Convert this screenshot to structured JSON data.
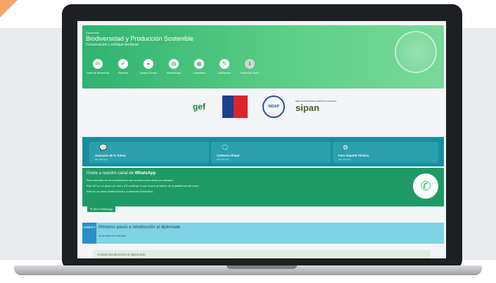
{
  "hero": {
    "label": "Diplomado",
    "title": "Biodiversidad y Producción Sostenible",
    "subtitle": "Conservación y enfoque territorial",
    "nav": [
      {
        "label": "Carta de bienvenida",
        "icon": "speech-bubble-icon"
      },
      {
        "label": "Objetivos",
        "icon": "check-icon"
      },
      {
        "label": "Equipo Técnico",
        "icon": "person-icon"
      },
      {
        "label": "Metodología",
        "icon": "document-icon"
      },
      {
        "label": "Calendario",
        "icon": "calendar-icon"
      },
      {
        "label": "Evaluación",
        "icon": "edit-icon"
      },
      {
        "label": "Fecha del Curso",
        "icon": "info-icon"
      }
    ]
  },
  "logos": {
    "gef": "gef",
    "indap": "INDAP",
    "sipan_small": "RED DE PATRIMONIO AGRÍCOLA NACIONAL",
    "sipan": "sipan"
  },
  "cards": [
    {
      "title": "Anuncios de la Tutora",
      "sub": "Mar 202 Appl"
    },
    {
      "title": "Cafetería Virtual",
      "sub": "Mar 202 Appl"
    },
    {
      "title": "Foro Soporte Técnico",
      "sub": "Mar 202 Appl"
    }
  ],
  "whatsapp": {
    "title_plain": "Únete a nuestro canal de ",
    "title_bold": "WhatsApp",
    "lines": [
      "Para enterarte de los recordatorios que enviamos dos veces por semana.",
      "Este NO es un grupo de chat y NO sustituye lo que ocurre al interior de la plataforma del curso.",
      "Este es un canal unidireccional y puramente informativo."
    ],
    "button": "Abrir WhatsApp"
  },
  "unidad": {
    "badge": "Unidad 0",
    "title": "Primeros pasos e introducción al diplomado",
    "dates": "15 de abril al 19 de abril",
    "intro": "Unidad introductoria al diplomado"
  },
  "colors": {
    "hero_green": "#3fbf7a",
    "teal": "#1a8e9c",
    "whatsapp_green": "#1f9a66",
    "unidad_blue": "#7fd3e3"
  }
}
